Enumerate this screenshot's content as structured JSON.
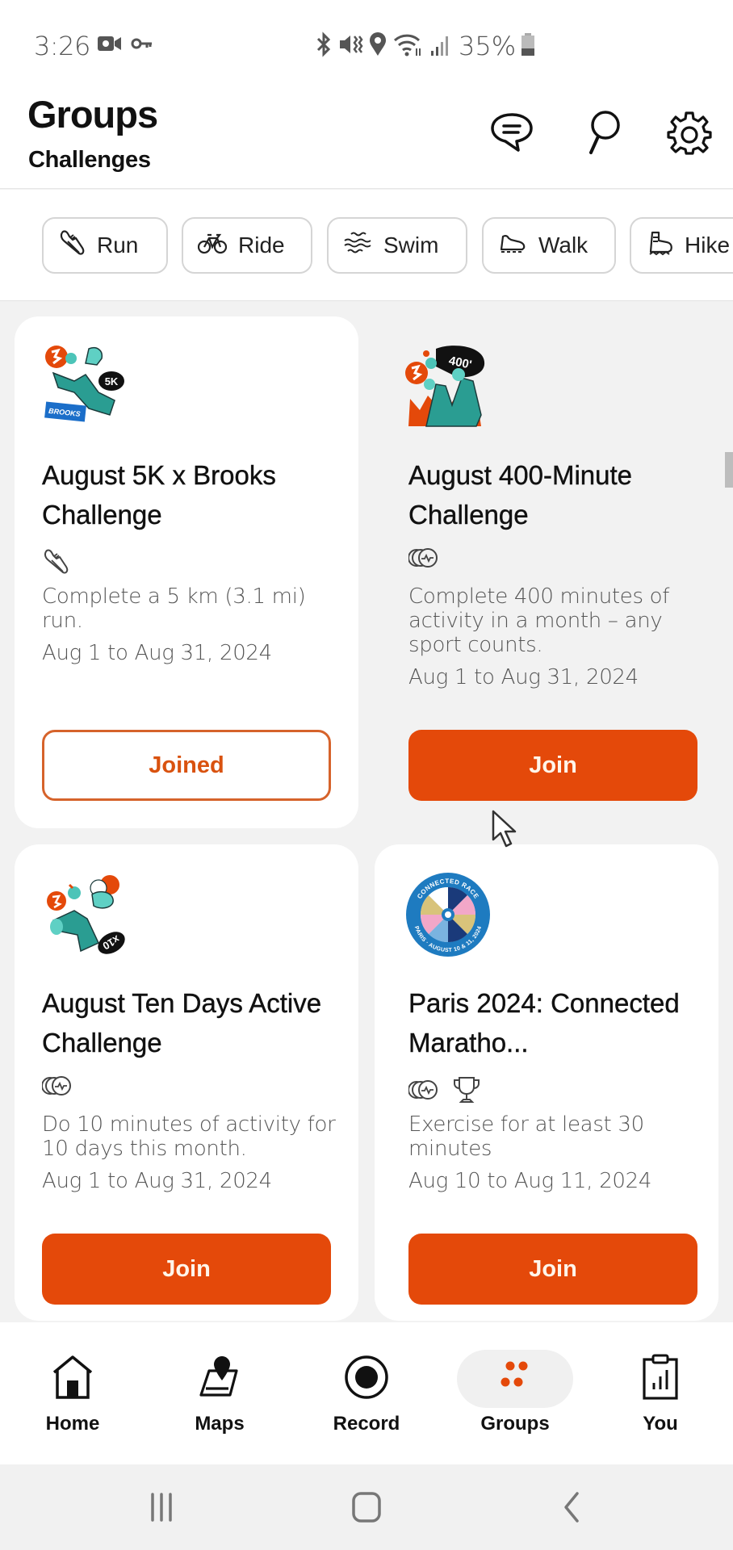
{
  "status_bar": {
    "time": "3:26",
    "left_icons": [
      "video-record-icon",
      "vpn-key-icon"
    ],
    "right_icons": [
      "bluetooth-icon",
      "mute-vibrate-icon",
      "location-icon",
      "wifi-icon",
      "signal-icon"
    ],
    "battery_percent": "35%",
    "battery_level": 0.35
  },
  "header": {
    "title": "Groups",
    "subtitle": "Challenges",
    "icons": [
      "messages-icon",
      "search-icon",
      "settings-icon"
    ]
  },
  "filters": [
    {
      "label": "Run",
      "icon": "run-shoe-icon"
    },
    {
      "label": "Ride",
      "icon": "bike-icon"
    },
    {
      "label": "Swim",
      "icon": "swim-waves-icon"
    },
    {
      "label": "Walk",
      "icon": "walk-shoe-icon"
    },
    {
      "label": "Hike",
      "icon": "hike-boot-icon"
    }
  ],
  "challenges": [
    {
      "title": "August 5K x Brooks Challenge",
      "badge_text": "5K",
      "brand_text": "BROOKS",
      "sport_icons": [
        "run-shoe-icon"
      ],
      "description": "Complete a 5 km (3.1 mi) run.",
      "dates": "Aug 1 to Aug 31, 2024",
      "button": "Joined",
      "joined": true
    },
    {
      "title": "August 400-Minute Challenge",
      "badge_text": "400'",
      "sport_icons": [
        "multisport-icon"
      ],
      "description": "Complete 400 minutes of activity in a month – any sport counts.",
      "dates": "Aug 1 to Aug 31, 2024",
      "button": "Join",
      "joined": false
    },
    {
      "title": "August Ten Days Active Challenge",
      "badge_text": "x10",
      "sport_icons": [
        "multisport-icon"
      ],
      "description": "Do 10 minutes of activity for 10 days this month.",
      "dates": "Aug 1 to Aug 31, 2024",
      "button": "Join",
      "joined": false
    },
    {
      "title": "Paris 2024: Connected Maratho...",
      "badge_text_top": "CONNECTED RACE",
      "badge_text_bottom": "PARIS · AUGUST 10 & 11, 2024",
      "sport_icons": [
        "multisport-icon",
        "trophy-icon"
      ],
      "description": "Exercise for at least 30 minutes",
      "dates": "Aug 10 to Aug 11, 2024",
      "button": "Join",
      "joined": false
    }
  ],
  "bottom_nav": [
    {
      "label": "Home",
      "icon": "home-icon",
      "active": false
    },
    {
      "label": "Maps",
      "icon": "maps-icon",
      "active": false
    },
    {
      "label": "Record",
      "icon": "record-icon",
      "active": false
    },
    {
      "label": "Groups",
      "icon": "groups-icon",
      "active": true
    },
    {
      "label": "You",
      "icon": "you-icon",
      "active": false
    }
  ],
  "system_nav": [
    "recent-apps-icon",
    "home-button-icon",
    "back-icon"
  ],
  "colors": {
    "accent": "#e4490a",
    "accent_text": "#d9520f",
    "background": "#f2f2f2",
    "card": "#ffffff"
  }
}
